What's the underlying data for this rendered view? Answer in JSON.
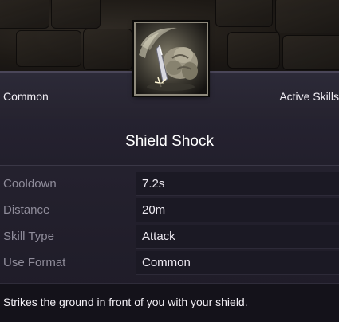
{
  "tooltip": {
    "rarity": "Common",
    "category": "Active Skills",
    "skill_name": "Shield Shock",
    "icon": "shield-shock-skill-icon",
    "stats": [
      {
        "label": "Cooldown",
        "value": "7.2s"
      },
      {
        "label": "Distance",
        "value": "20m"
      },
      {
        "label": "Skill Type",
        "value": "Attack"
      },
      {
        "label": "Use Format",
        "value": "Common"
      }
    ],
    "description": "Strikes the ground in front of you with your shield."
  },
  "colors": {
    "panel_bg": "#24212e",
    "label_text": "#8f8c9a",
    "value_text": "#eeeaf2",
    "icon_border": "#8f8a7c"
  }
}
